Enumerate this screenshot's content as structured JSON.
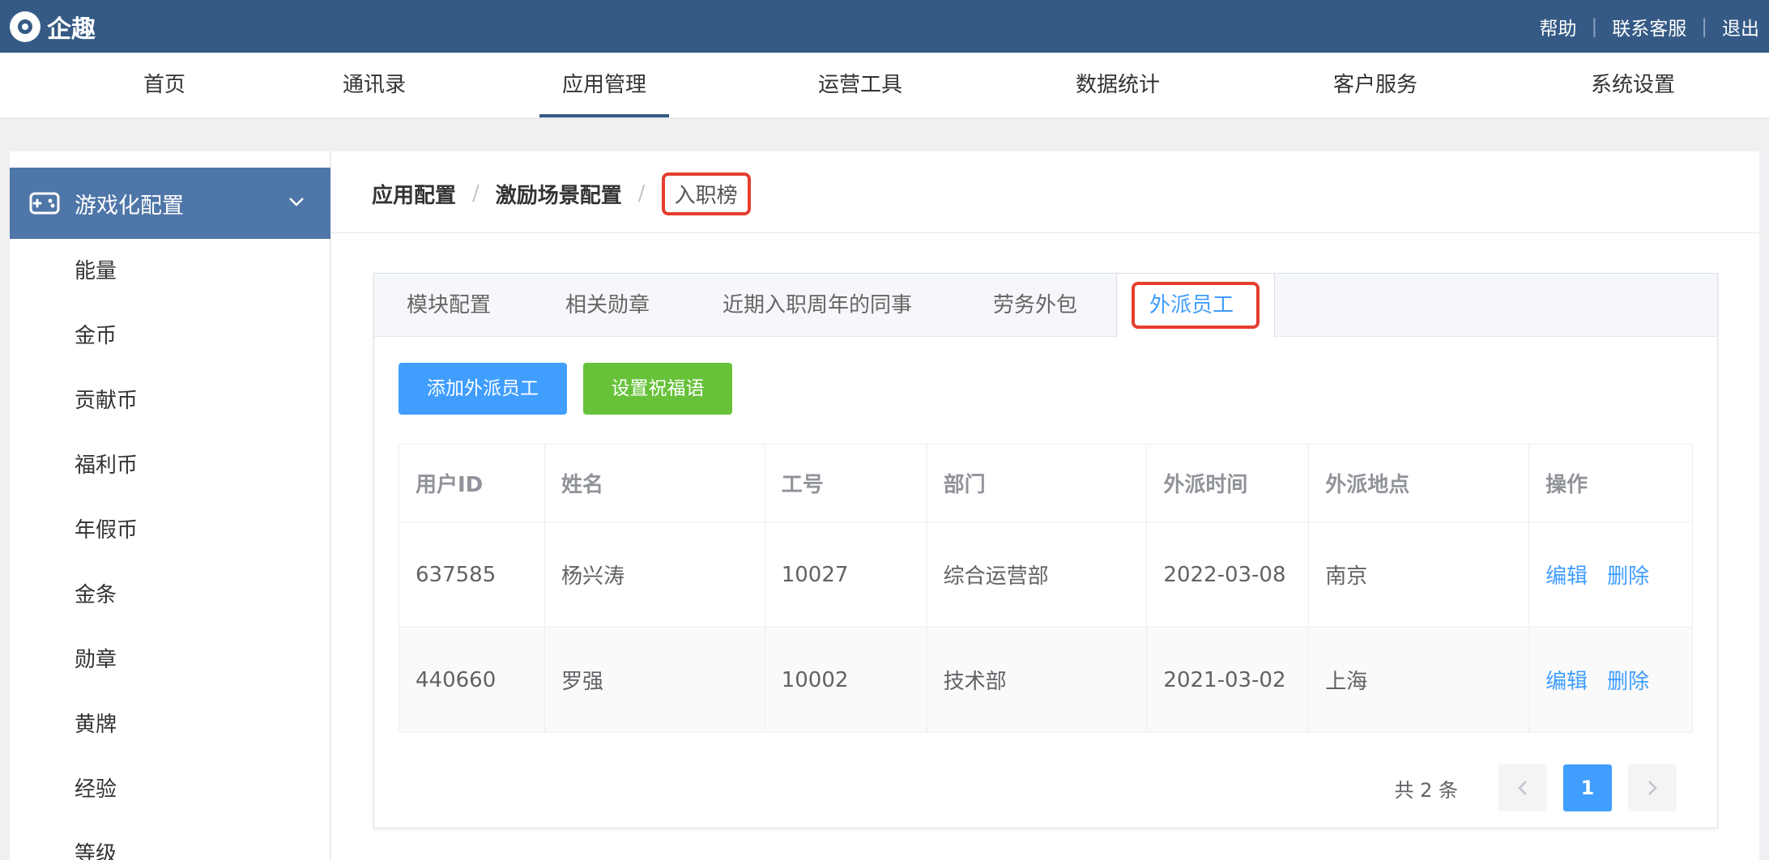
{
  "app": {
    "title": "企趣"
  },
  "top_links": [
    "帮助",
    "联系客服",
    "退出"
  ],
  "nav": {
    "items": [
      "首页",
      "通讯录",
      "应用管理",
      "运营工具",
      "数据统计",
      "客户服务",
      "系统设置"
    ],
    "active": "应用管理"
  },
  "sidebar": {
    "header": "游戏化配置",
    "items": [
      "能量",
      "金币",
      "贡献币",
      "福利币",
      "年假币",
      "金条",
      "勋章",
      "黄牌",
      "经验",
      "等级"
    ]
  },
  "breadcrumb": {
    "items": [
      "应用配置",
      "激励场景配置"
    ],
    "current": "入职榜"
  },
  "tabs": {
    "items": [
      "模块配置",
      "相关勋章",
      "近期入职周年的同事",
      "劳务外包",
      "外派员工"
    ],
    "active": "外派员工"
  },
  "buttons": {
    "add": "添加外派员工",
    "greeting": "设置祝福语"
  },
  "table": {
    "headers": [
      "用户ID",
      "姓名",
      "工号",
      "部门",
      "外派时间",
      "外派地点",
      "操作"
    ],
    "rows": [
      [
        "637585",
        "杨兴涛",
        "10027",
        "综合运营部",
        "2022-03-08",
        "南京"
      ],
      [
        "440660",
        "罗强",
        "10002",
        "技术部",
        "2021-03-02",
        "上海"
      ]
    ],
    "actions": [
      "编辑",
      "删除"
    ]
  },
  "pagination": {
    "total_text": "共 2 条",
    "current_page": "1"
  },
  "colors": {
    "topbar": "#355a85",
    "sidebar_active": "#4f76a8",
    "primary": "#409eff",
    "success": "#67c23a",
    "highlight": "#e53e2f"
  }
}
